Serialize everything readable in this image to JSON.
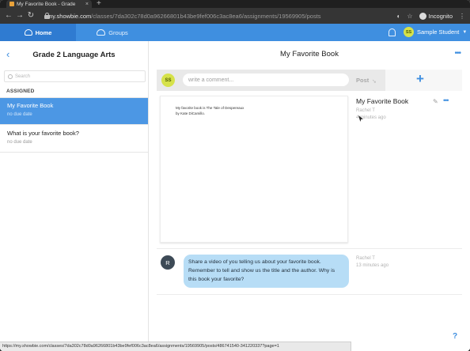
{
  "browser": {
    "tab_title": "My Favorite Book - Grade",
    "new_tab_symbol": "+",
    "url_host": "my.showbie.com",
    "url_path": "/classes/7da302c78d0a96266801b43be9fef006c3ac8ea6/assignments/19569905/posts",
    "incognito_label": "Incognito",
    "status_url": "https://my.showbie.com/classes/7da302c78d0a96266801b43be9fef006c3ac8ea6/assignments/19569905/posts/486741540-341220337?page=1"
  },
  "header": {
    "home_label": "Home",
    "groups_label": "Groups",
    "user_initials": "SS",
    "user_name": "Sample Student"
  },
  "sidebar": {
    "title": "Grade 2 Language Arts",
    "search_placeholder": "Search",
    "section_label": "ASSIGNED",
    "items": [
      {
        "name": "My Favorite Book",
        "due": "no due date"
      },
      {
        "name": "What is your favorite book?",
        "due": "no due date"
      }
    ]
  },
  "main": {
    "title": "My Favorite Book",
    "composer": {
      "avatar_initials": "SS",
      "placeholder": "write a comment...",
      "post_label": "Post",
      "add_symbol": "+"
    },
    "post": {
      "text": "My favorite book is The Tale of Despereaux by Kate DiCamillo.",
      "title": "My Favorite Book",
      "author": "Rachel T",
      "time": "4 minutes ago"
    },
    "comment": {
      "avatar_initial": "R",
      "text": "Share a video of you telling us about your favorite book. Remember to tell and show us the title and the author. Why is this book your favorite?",
      "author": "Rachel T",
      "time": "13 minutes ago"
    },
    "help_symbol": "?"
  },
  "colors": {
    "brand_blue": "#3f8fe0",
    "active_item": "#4c97e4",
    "comment_bubble": "#b7ddf6",
    "avatar_yellow": "#d6e24a"
  }
}
